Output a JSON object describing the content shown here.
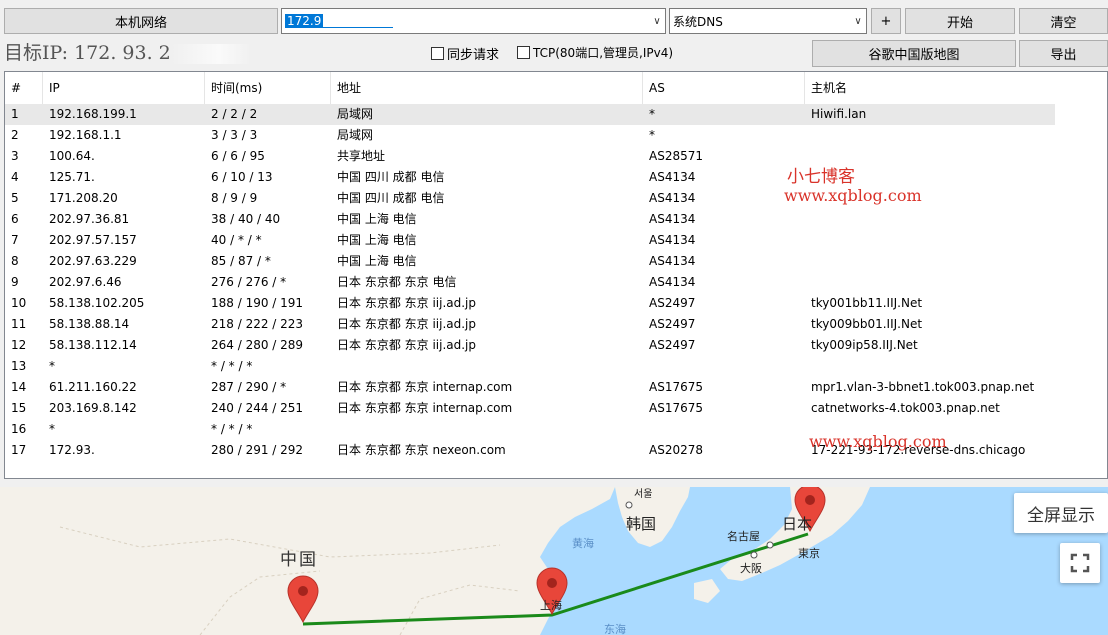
{
  "toolbar": {
    "local_network_label": "本机网络",
    "target_input_value": "172.9",
    "dns_select_value": "系统DNS",
    "plus_label": "+",
    "start_label": "开始",
    "clear_label": "清空"
  },
  "row2": {
    "target_ip_prefix": "目标IP:",
    "target_ip_value": "172. 93. 2",
    "sync_request_label": "同步请求",
    "tcp_label": "TCP(80端口,管理员,IPv4)",
    "google_map_label": "谷歌中国版地图",
    "export_label": "导出"
  },
  "table": {
    "headers": [
      "#",
      "IP",
      "时间(ms)",
      "地址",
      "AS",
      "主机名"
    ],
    "rows": [
      {
        "n": "1",
        "ip": "192.168.199.1",
        "time": "2 / 2 / 2",
        "addr": "局域网",
        "as": "*",
        "host": "Hiwifi.lan"
      },
      {
        "n": "2",
        "ip": "192.168.1.1",
        "time": "3 / 3 / 3",
        "addr": "局域网",
        "as": "*",
        "host": ""
      },
      {
        "n": "3",
        "ip": "100.64.",
        "time": "6 / 6 / 95",
        "addr": "共享地址",
        "as": "AS28571",
        "host": ""
      },
      {
        "n": "4",
        "ip": "125.71.",
        "time": "6 / 10 / 13",
        "addr": "中国 四川 成都 电信",
        "as": "AS4134",
        "host": ""
      },
      {
        "n": "5",
        "ip": "171.208.20",
        "time": "8 / 9 / 9",
        "addr": "中国 四川 成都 电信",
        "as": "AS4134",
        "host": ""
      },
      {
        "n": "6",
        "ip": "202.97.36.81",
        "time": "38 / 40 / 40",
        "addr": "中国 上海 电信",
        "as": "AS4134",
        "host": ""
      },
      {
        "n": "7",
        "ip": "202.97.57.157",
        "time": "40 / * / *",
        "addr": "中国 上海 电信",
        "as": "AS4134",
        "host": ""
      },
      {
        "n": "8",
        "ip": "202.97.63.229",
        "time": "85 / 87 / *",
        "addr": "中国 上海 电信",
        "as": "AS4134",
        "host": ""
      },
      {
        "n": "9",
        "ip": "202.97.6.46",
        "time": "276 / 276 / *",
        "addr": "日本 东京都 东京 电信",
        "as": "AS4134",
        "host": ""
      },
      {
        "n": "10",
        "ip": "58.138.102.205",
        "time": "188 / 190 / 191",
        "addr": "日本 东京都 东京 iij.ad.jp",
        "as": "AS2497",
        "host": "tky001bb11.IIJ.Net"
      },
      {
        "n": "11",
        "ip": "58.138.88.14",
        "time": "218 / 222 / 223",
        "addr": "日本 东京都 东京 iij.ad.jp",
        "as": "AS2497",
        "host": "tky009bb01.IIJ.Net"
      },
      {
        "n": "12",
        "ip": "58.138.112.14",
        "time": "264 / 280 / 289",
        "addr": "日本 东京都 东京 iij.ad.jp",
        "as": "AS2497",
        "host": "tky009ip58.IIJ.Net"
      },
      {
        "n": "13",
        "ip": "*",
        "time": "* / * / *",
        "addr": "",
        "as": "",
        "host": ""
      },
      {
        "n": "14",
        "ip": "61.211.160.22",
        "time": "287 / 290 / *",
        "addr": "日本 东京都 东京 internap.com",
        "as": "AS17675",
        "host": "mpr1.vlan-3-bbnet1.tok003.pnap.net"
      },
      {
        "n": "15",
        "ip": "203.169.8.142",
        "time": "240 / 244 / 251",
        "addr": "日本 东京都 东京 internap.com",
        "as": "AS17675",
        "host": "catnetworks-4.tok003.pnap.net"
      },
      {
        "n": "16",
        "ip": "*",
        "time": "* / * / *",
        "addr": "",
        "as": "",
        "host": ""
      },
      {
        "n": "17",
        "ip": "172.93.",
        "time": "280 / 291 / 292",
        "addr": "日本 东京都 东京 nexeon.com",
        "as": "AS20278",
        "host": "17-221-93-172.reverse-dns.chicago"
      }
    ]
  },
  "watermark": {
    "line1": "小七博客",
    "line2": "www.xqblog.com",
    "line3": "www.xqblog.com"
  },
  "map": {
    "labels": {
      "china": "中国",
      "korea": "韩国",
      "yellow_sea": "黄海",
      "east_sea": "东海",
      "shanghai": "上海",
      "nagoya": "名古屋",
      "osaka": "大阪",
      "tokyo": "東京",
      "japan": "日本",
      "seoul": "서울"
    },
    "fullscreen_label": "全屏显示"
  },
  "colors": {
    "route": "#1a8a1a",
    "pin": "#e8463a",
    "watermark": "#d9332a"
  }
}
